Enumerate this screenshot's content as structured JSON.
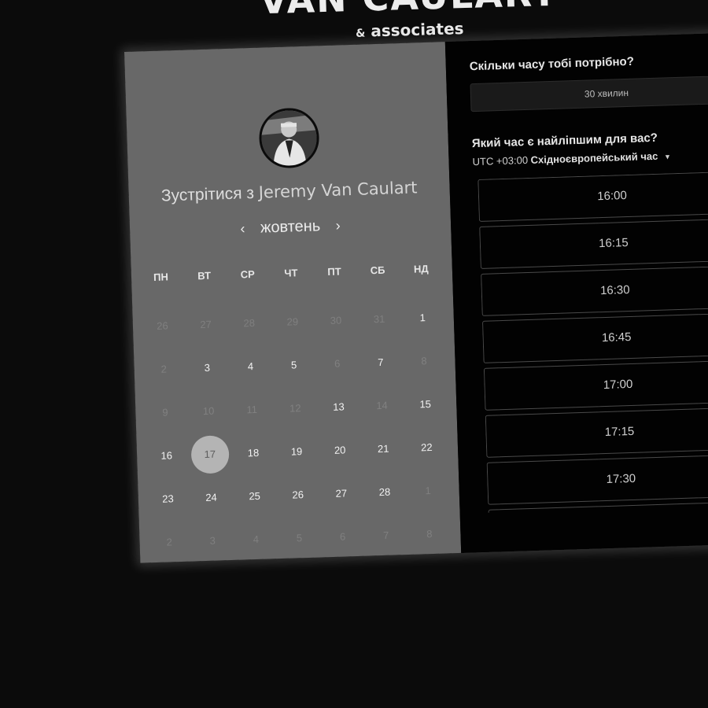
{
  "brand": {
    "title": "VAN CAULART",
    "subtitle_amp": "&",
    "subtitle": "associates"
  },
  "host": {
    "meet_prefix": "Зустрітися з",
    "name": "Jeremy Van Caulart"
  },
  "calendar": {
    "month": "жовтень",
    "prev_icon": "chevron-left",
    "next_icon": "chevron-right",
    "weekdays": [
      "ПН",
      "ВТ",
      "СР",
      "ЧТ",
      "ПТ",
      "СБ",
      "НД"
    ],
    "days": [
      {
        "label": "26",
        "state": "other-month"
      },
      {
        "label": "27",
        "state": "other-month"
      },
      {
        "label": "28",
        "state": "other-month"
      },
      {
        "label": "29",
        "state": "other-month"
      },
      {
        "label": "30",
        "state": "other-month"
      },
      {
        "label": "31",
        "state": "other-month"
      },
      {
        "label": "1",
        "state": "available"
      },
      {
        "label": "2",
        "state": "unavailable"
      },
      {
        "label": "3",
        "state": "available"
      },
      {
        "label": "4",
        "state": "available"
      },
      {
        "label": "5",
        "state": "available"
      },
      {
        "label": "6",
        "state": "unavailable"
      },
      {
        "label": "7",
        "state": "available"
      },
      {
        "label": "8",
        "state": "unavailable"
      },
      {
        "label": "9",
        "state": "unavailable"
      },
      {
        "label": "10",
        "state": "unavailable"
      },
      {
        "label": "11",
        "state": "unavailable"
      },
      {
        "label": "12",
        "state": "unavailable"
      },
      {
        "label": "13",
        "state": "available"
      },
      {
        "label": "14",
        "state": "unavailable"
      },
      {
        "label": "15",
        "state": "available"
      },
      {
        "label": "16",
        "state": "available"
      },
      {
        "label": "17",
        "state": "selected"
      },
      {
        "label": "18",
        "state": "available"
      },
      {
        "label": "19",
        "state": "available"
      },
      {
        "label": "20",
        "state": "available"
      },
      {
        "label": "21",
        "state": "available"
      },
      {
        "label": "22",
        "state": "available"
      },
      {
        "label": "23",
        "state": "available"
      },
      {
        "label": "24",
        "state": "available"
      },
      {
        "label": "25",
        "state": "available"
      },
      {
        "label": "26",
        "state": "available"
      },
      {
        "label": "27",
        "state": "available"
      },
      {
        "label": "28",
        "state": "available"
      },
      {
        "label": "1",
        "state": "other-month"
      },
      {
        "label": "2",
        "state": "other-month"
      },
      {
        "label": "3",
        "state": "other-month"
      },
      {
        "label": "4",
        "state": "other-month"
      },
      {
        "label": "5",
        "state": "other-month"
      },
      {
        "label": "6",
        "state": "other-month"
      },
      {
        "label": "7",
        "state": "other-month"
      },
      {
        "label": "8",
        "state": "other-month"
      }
    ]
  },
  "booking": {
    "duration_question": "Скільки часу тобі потрібно?",
    "duration_value": "30 хвилин",
    "time_question": "Який час є найліпшим для вас?",
    "timezone_offset": "UTC +03:00",
    "timezone_name": "Східноєвропейський час",
    "timezone_caret_icon": "caret-down",
    "slots": [
      "16:00",
      "16:15",
      "16:30",
      "16:45",
      "17:00",
      "17:15",
      "17:30",
      ""
    ]
  },
  "colors": {
    "page_bg": "#0b0b0b",
    "left_panel": "#686868",
    "right_panel": "#020202",
    "selected_day": "#b4b4b4"
  }
}
